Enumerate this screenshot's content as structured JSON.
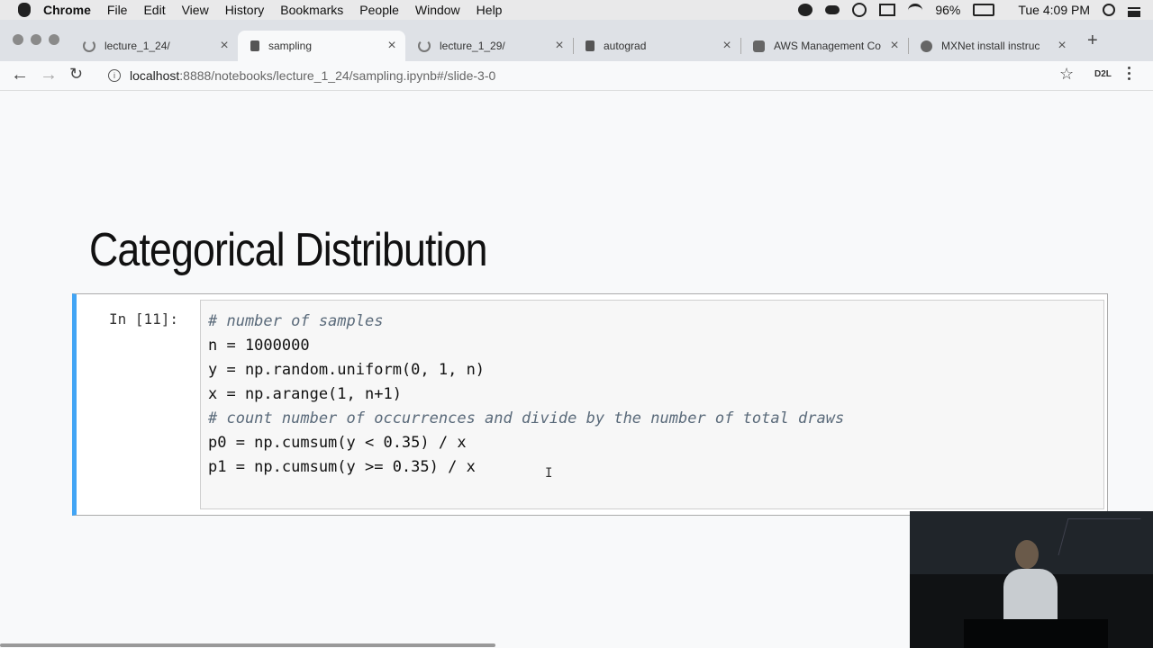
{
  "menubar": {
    "app": "Chrome",
    "items": [
      "File",
      "Edit",
      "View",
      "History",
      "Bookmarks",
      "People",
      "Window",
      "Help"
    ],
    "battery": "96%",
    "clock": "Tue 4:09 PM"
  },
  "tabs": [
    {
      "title": "lecture_1_24/",
      "icon": "loading-icon"
    },
    {
      "title": "sampling",
      "icon": "notebook-icon"
    },
    {
      "title": "lecture_1_29/",
      "icon": "loading-icon"
    },
    {
      "title": "autograd",
      "icon": "notebook-icon"
    },
    {
      "title": "AWS Management Co",
      "icon": "aws-icon"
    },
    {
      "title": "MXNet install instruc",
      "icon": "mxnet-icon"
    }
  ],
  "toolbar": {
    "url_host": "localhost",
    "url_path": ":8888/notebooks/lecture_1_24/sampling.ipynb#/slide-3-0",
    "extension_label": "D2L"
  },
  "slide": {
    "title": "Categorical Distribution",
    "cell_prompt": "In [11]:",
    "code_lines": [
      {
        "text": "# number of samples",
        "comment": true
      },
      {
        "text": "n = 1000000",
        "comment": false
      },
      {
        "text": "y = np.random.uniform(0, 1, n)",
        "comment": false
      },
      {
        "text": "x = np.arange(1, n+1)",
        "comment": false
      },
      {
        "text": "# count number of occurrences and divide by the number of total draws",
        "comment": true
      },
      {
        "text": "p0 = np.cumsum(y < 0.35) / x",
        "comment": false
      },
      {
        "text": "p1 = np.cumsum(y >= 0.35) / x",
        "comment": false
      }
    ]
  }
}
